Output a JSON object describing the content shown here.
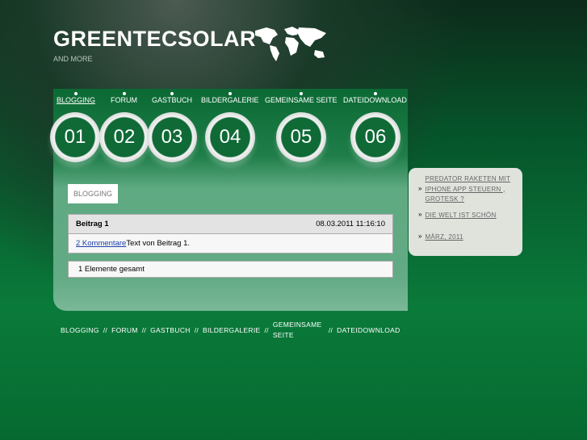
{
  "header": {
    "title": "GREENTECSOLAR",
    "subtitle": "AND MORE"
  },
  "nav": [
    {
      "label": "BLOGGING",
      "num": "01"
    },
    {
      "label": "FORUM",
      "num": "02"
    },
    {
      "label": "GASTBUCH",
      "num": "03"
    },
    {
      "label": "BILDERGALERIE",
      "num": "04"
    },
    {
      "label": "GEMEINSAME SEITE",
      "num": "05"
    },
    {
      "label": "DATEIDOWNLOAD",
      "num": "06"
    }
  ],
  "section_tab": "BLOGGING",
  "post": {
    "title": "Beitrag 1",
    "date": "08.03.2011 11:16:10",
    "comments": "2 Kommentare",
    "text": "Text von Beitrag 1."
  },
  "total": "1 Elemente gesamt",
  "sidebar": [
    {
      "bullet": "»",
      "label": "PREDATOR RAKETEN MIT IPHONE APP STEUERN , GROTESK ?"
    },
    {
      "bullet": "»",
      "label": "DIE WELT IST SCHÖN"
    },
    {
      "bullet": "»",
      "label": "MÄRZ, 2011"
    }
  ],
  "footer": {
    "sep": "//",
    "items": [
      "BLOGGING",
      "FORUM",
      "GASTBUCH",
      "BILDERGALERIE",
      "GEMEINSAME SEITE",
      "DATEIDOWNLOAD"
    ]
  }
}
